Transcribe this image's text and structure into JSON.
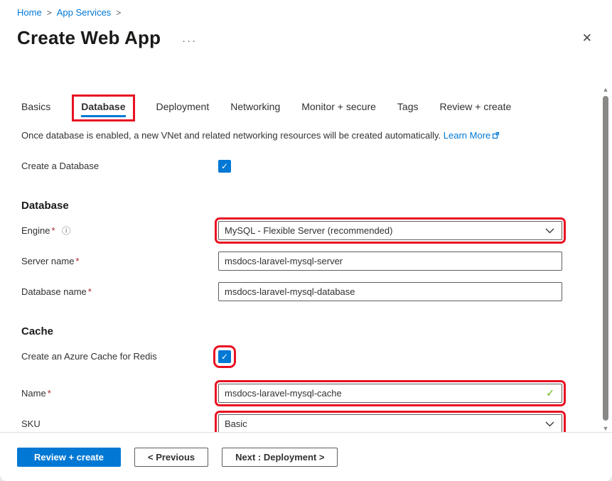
{
  "breadcrumb": {
    "separator": ">",
    "items": [
      {
        "label": "Home"
      },
      {
        "label": "App Services"
      }
    ]
  },
  "header": {
    "title": "Create Web App",
    "more_label": "···",
    "close_label": "✕"
  },
  "tabs": {
    "items": [
      {
        "label": "Basics",
        "active": false
      },
      {
        "label": "Database",
        "active": true,
        "annotated": true
      },
      {
        "label": "Deployment",
        "active": false
      },
      {
        "label": "Networking",
        "active": false
      },
      {
        "label": "Monitor + secure",
        "active": false
      },
      {
        "label": "Tags",
        "active": false
      },
      {
        "label": "Review + create",
        "active": false
      }
    ]
  },
  "notice": {
    "text": "Once database is enabled, a new VNet and related networking resources will be created automatically.",
    "link_label": "Learn More"
  },
  "form": {
    "required_marker": "*",
    "create_database": {
      "label": "Create a Database",
      "checked": true
    },
    "database": {
      "heading": "Database",
      "engine": {
        "label": "Engine",
        "required": true,
        "value": "MySQL - Flexible Server (recommended)",
        "annotated": true
      },
      "server_name": {
        "label": "Server name",
        "required": true,
        "value": "msdocs-laravel-mysql-server"
      },
      "database_name": {
        "label": "Database name",
        "required": true,
        "value": "msdocs-laravel-mysql-database"
      }
    },
    "cache": {
      "heading": "Cache",
      "create_cache": {
        "label": "Create an Azure Cache for Redis",
        "checked": true,
        "annotated": true
      },
      "name": {
        "label": "Name",
        "required": true,
        "value": "msdocs-laravel-mysql-cache",
        "valid": true,
        "annotated": true
      },
      "sku": {
        "label": "SKU",
        "required": false,
        "value": "Basic",
        "annotated": true
      }
    }
  },
  "footer": {
    "review_create_label": "Review + create",
    "previous_label": "< Previous",
    "next_label": "Next : Deployment >"
  },
  "icons": {
    "check": "✓",
    "info": "ⓘ",
    "scroll_up": "▲",
    "scroll_down": "▼"
  },
  "colors": {
    "accent_blue": "#0078d4",
    "annotation_red": "#e81123",
    "valid_green": "#5db300",
    "required_red": "#a4262c"
  }
}
